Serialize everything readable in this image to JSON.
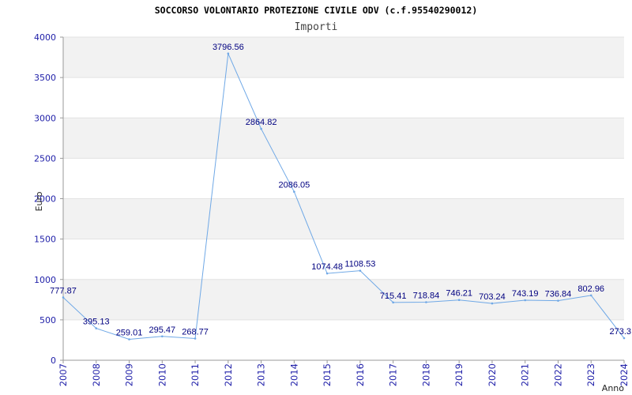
{
  "chart_data": {
    "type": "line",
    "title": "SOCCORSO VOLONTARIO PROTEZIONE CIVILE ODV (c.f.95540290012)",
    "subtitle": "Importi",
    "xlabel": "Anno",
    "ylabel": "Euro",
    "x": [
      "2007",
      "2008",
      "2009",
      "2010",
      "2011",
      "2012",
      "2013",
      "2014",
      "2015",
      "2016",
      "2017",
      "2018",
      "2019",
      "2020",
      "2021",
      "2022",
      "2023",
      "2024"
    ],
    "series": [
      {
        "values": [
          777.87,
          395.13,
          259.01,
          295.47,
          268.77,
          3796.56,
          2864.82,
          2086.05,
          1074.48,
          1108.53,
          715.41,
          718.84,
          746.21,
          703.24,
          743.19,
          736.84,
          802.96,
          273.3
        ],
        "data_labels": true
      }
    ],
    "y_ticks": [
      0,
      500,
      1000,
      1500,
      2000,
      2500,
      3000,
      3500,
      4000
    ],
    "ylim": [
      0,
      4000
    ],
    "grid": true,
    "colors": {
      "line": "#6fa8e6",
      "tick_labels": "#1e1ea8",
      "data_labels": "#000080",
      "band": "#f2f2f2",
      "gridline": "#e2e2e2",
      "axis": "#9a9a9a"
    }
  }
}
